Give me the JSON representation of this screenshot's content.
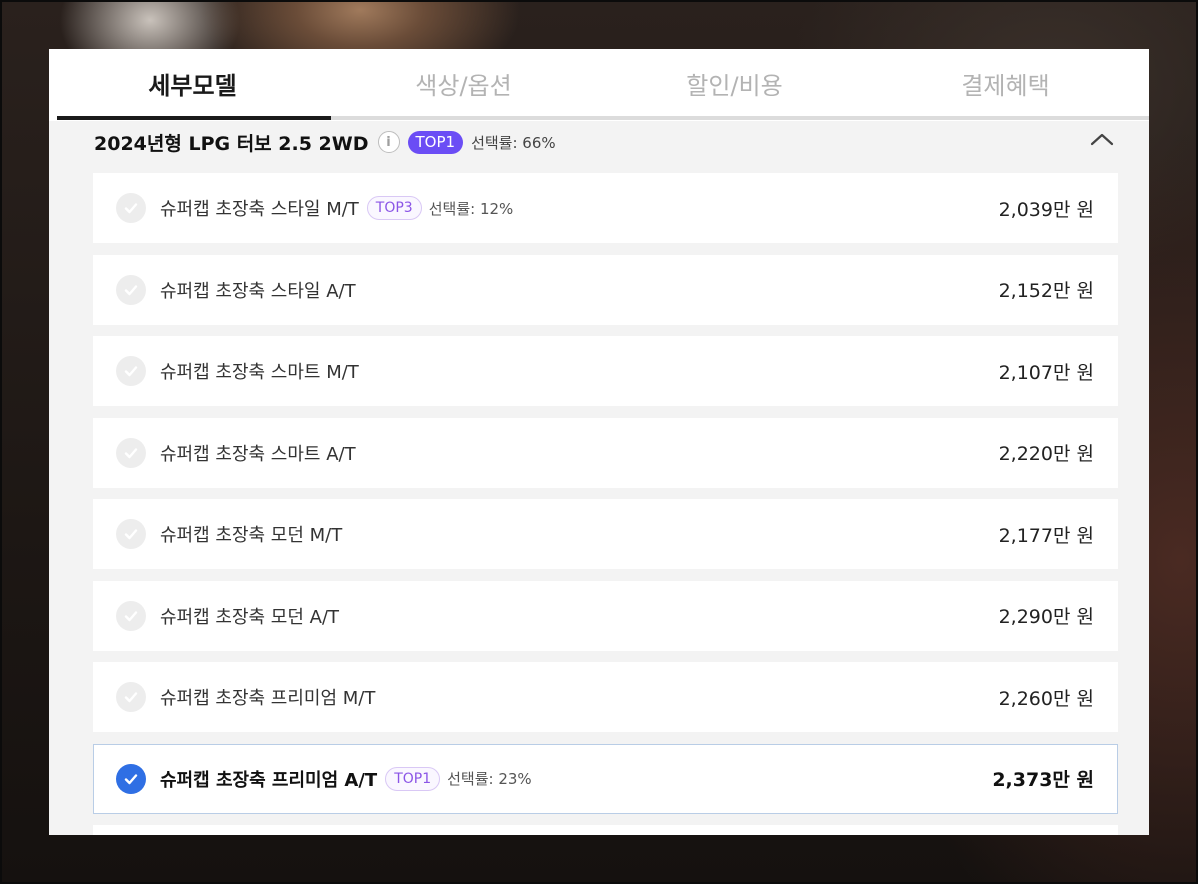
{
  "tabs": [
    {
      "label": "세부모델",
      "active": true
    },
    {
      "label": "색상/옵션",
      "active": false
    },
    {
      "label": "할인/비용",
      "active": false
    },
    {
      "label": "결제혜택",
      "active": false
    }
  ],
  "group": {
    "title": "2024년형 LPG 터보 2.5 2WD",
    "info_icon": "i",
    "badge": "TOP1",
    "select_rate": "선택률: 66%"
  },
  "models": [
    {
      "name": "슈퍼캡 초장축 스타일 M/T",
      "price": "2,039만 원",
      "badge": "TOP3",
      "rate": "선택률: 12%",
      "selected": false
    },
    {
      "name": "슈퍼캡 초장축 스타일 A/T",
      "price": "2,152만 원",
      "badge": "",
      "rate": "",
      "selected": false
    },
    {
      "name": "슈퍼캡 초장축 스마트 M/T",
      "price": "2,107만 원",
      "badge": "",
      "rate": "",
      "selected": false
    },
    {
      "name": "슈퍼캡 초장축 스마트 A/T",
      "price": "2,220만 원",
      "badge": "",
      "rate": "",
      "selected": false
    },
    {
      "name": "슈퍼캡 초장축 모던 M/T",
      "price": "2,177만 원",
      "badge": "",
      "rate": "",
      "selected": false
    },
    {
      "name": "슈퍼캡 초장축 모던 A/T",
      "price": "2,290만 원",
      "badge": "",
      "rate": "",
      "selected": false
    },
    {
      "name": "슈퍼캡 초장축 프리미엄 M/T",
      "price": "2,260만 원",
      "badge": "",
      "rate": "",
      "selected": false
    },
    {
      "name": "슈퍼캡 초장축 프리미엄 A/T",
      "price": "2,373만 원",
      "badge": "TOP1",
      "rate": "선택률: 23%",
      "selected": true
    }
  ],
  "colors": {
    "accent": "#2f6fe4",
    "badge_solid": "#6b4df5",
    "badge_outline": "#8b55e6"
  }
}
